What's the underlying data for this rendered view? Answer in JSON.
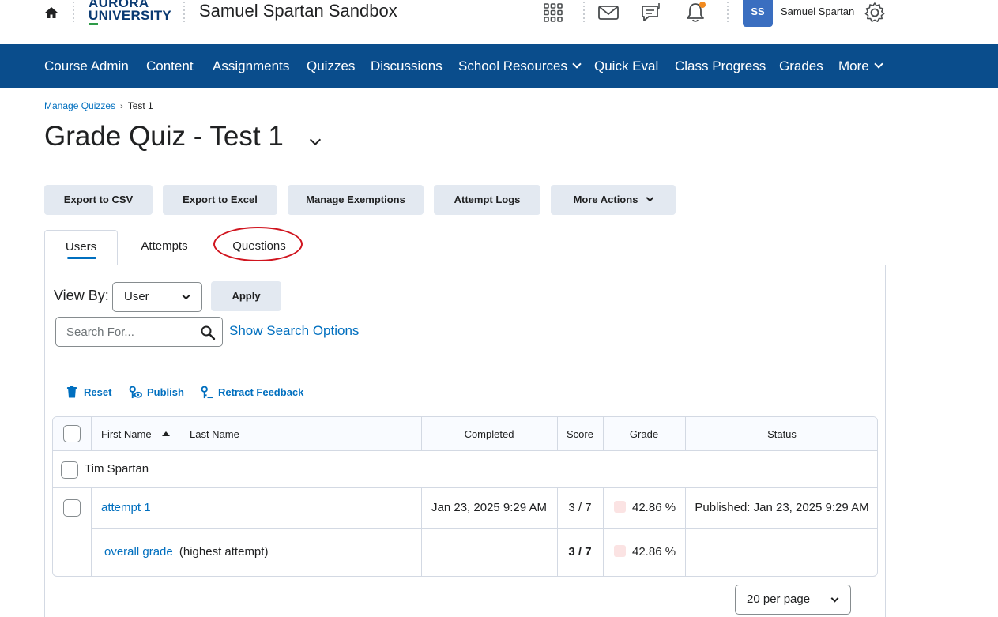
{
  "header": {
    "logo_line1": "AURORA",
    "logo_line2": "UNIVERSITY",
    "course_title": "Samuel Spartan Sandbox",
    "user_initials": "SS",
    "user_name": "Samuel Spartan",
    "icons": [
      "home-icon",
      "waffle-grid-icon",
      "mail-icon",
      "chat-icon",
      "bell-icon",
      "gear-icon"
    ],
    "accent_color": "#0a4d8c",
    "notification_dot_color": "#f28b20"
  },
  "nav": {
    "items": [
      {
        "label": "Course Admin"
      },
      {
        "label": "Content"
      },
      {
        "label": "Assignments"
      },
      {
        "label": "Quizzes"
      },
      {
        "label": "Discussions"
      },
      {
        "label": "School Resources",
        "dropdown": true
      },
      {
        "label": "Quick Eval"
      },
      {
        "label": "Class Progress"
      },
      {
        "label": "Grades"
      },
      {
        "label": "More",
        "dropdown": true
      }
    ]
  },
  "breadcrumb": {
    "parent": "Manage Quizzes",
    "separator": "›",
    "current": "Test 1"
  },
  "page": {
    "title": "Grade Quiz - Test 1"
  },
  "actions": {
    "export_csv": "Export to CSV",
    "export_excel": "Export to Excel",
    "manage_exemptions": "Manage Exemptions",
    "attempt_logs": "Attempt Logs",
    "more_actions": "More Actions"
  },
  "tabs": {
    "users": "Users",
    "attempts": "Attempts",
    "questions": "Questions",
    "active": "Users"
  },
  "filters": {
    "view_by_label": "View By:",
    "view_by_value": "User",
    "apply": "Apply",
    "search_placeholder": "Search For...",
    "show_search_options": "Show Search Options"
  },
  "row_actions": {
    "reset": "Reset",
    "publish": "Publish",
    "retract_feedback": "Retract Feedback"
  },
  "table": {
    "headers": {
      "first_name": "First Name",
      "last_name": "Last Name",
      "completed": "Completed",
      "score": "Score",
      "grade": "Grade",
      "status": "Status"
    },
    "user": {
      "name": "Tim Spartan",
      "attempt": {
        "label": "attempt 1",
        "completed": "Jan 23, 2025 9:29 AM",
        "score": "3 / 7",
        "grade": "42.86 %",
        "status": "Published: Jan 23, 2025 9:29 AM"
      },
      "overall": {
        "label": "overall grade",
        "note": "(highest attempt)",
        "score": "3 / 7",
        "grade": "42.86 %"
      }
    }
  },
  "pagination": {
    "per_page": "20 per page"
  },
  "annotation_color": "#d0141e"
}
